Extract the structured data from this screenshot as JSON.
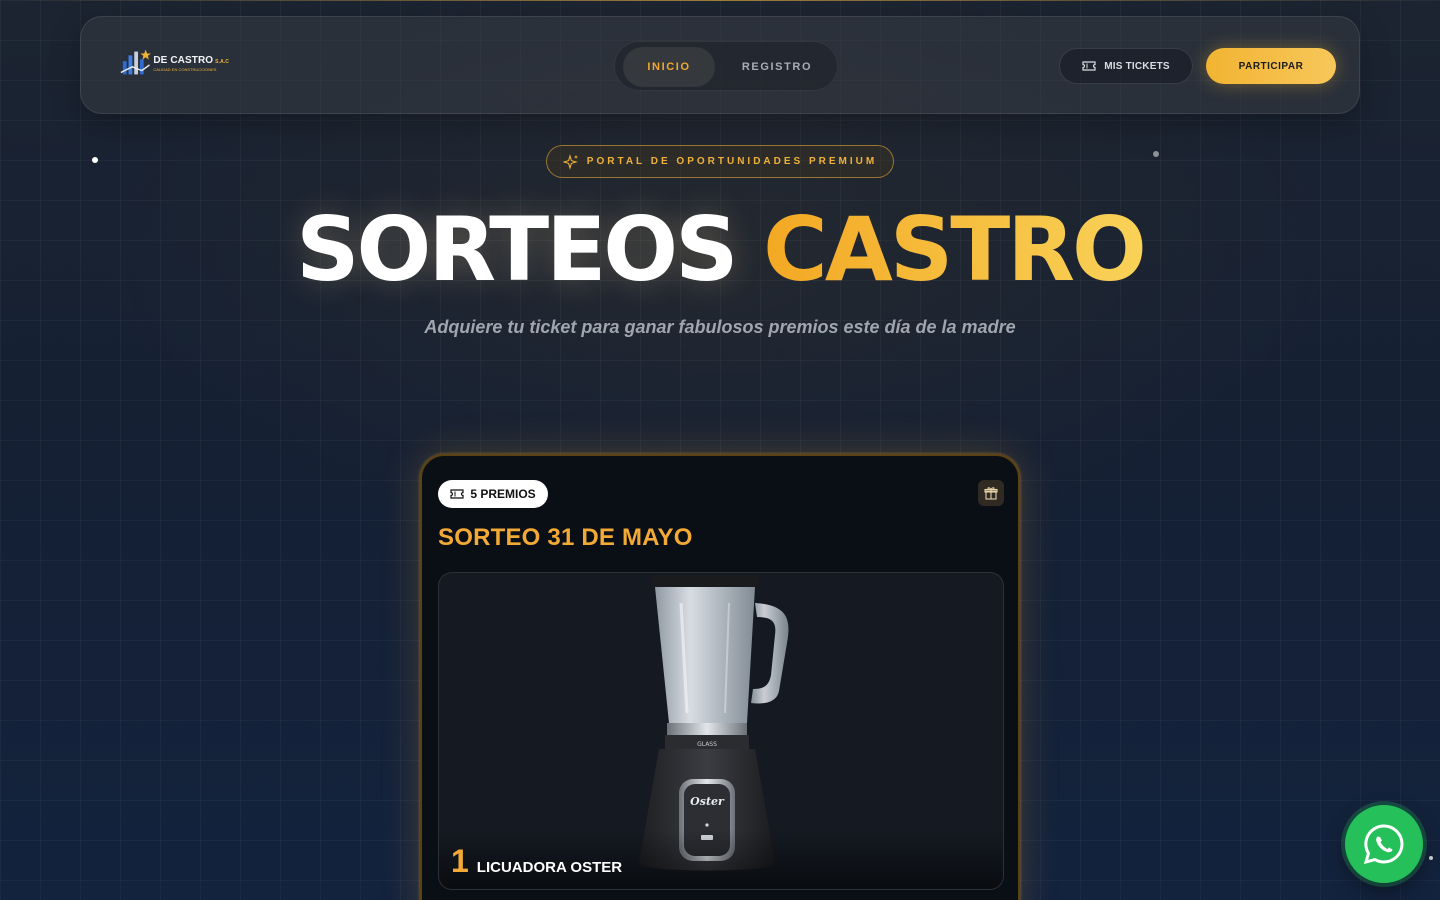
{
  "brand": {
    "name": "DE CASTRO",
    "suffix": "S.A.C",
    "tagline": "CALIDAD EN CONSTRUCCIONES",
    "logo_icon": "building-star-icon"
  },
  "nav": {
    "items": [
      {
        "label": "INICIO",
        "active": true
      },
      {
        "label": "REGISTRO",
        "active": false
      }
    ]
  },
  "header_actions": {
    "tickets_label": "MIS TICKETS",
    "tickets_icon": "ticket-icon",
    "participate_label": "PARTICIPAR"
  },
  "hero": {
    "badge_icon": "sparkles-icon",
    "badge": "PORTAL DE OPORTUNIDADES PREMIUM",
    "title_part1": "SORTEOS",
    "title_part2": "CASTRO",
    "subtitle": "Adquiere tu ticket para ganar fabulosos premios este día de la madre"
  },
  "raffle_card": {
    "prizes_badge": "5 PREMIOS",
    "prizes_icon": "ticket-icon",
    "gift_icon": "gift-icon",
    "title": "SORTEO 31 DE MAYO",
    "prize": {
      "number": "1",
      "name": "LICUADORA OSTER",
      "brand_on_image": "Oster",
      "image": "blender-image"
    }
  },
  "floating": {
    "whatsapp_icon": "whatsapp-icon"
  },
  "colors": {
    "accent": "#f2a935",
    "accent_light": "#f9d258",
    "bg_dark": "#152033",
    "card_bg": "#0a0e15",
    "whatsapp": "#25c05a"
  }
}
